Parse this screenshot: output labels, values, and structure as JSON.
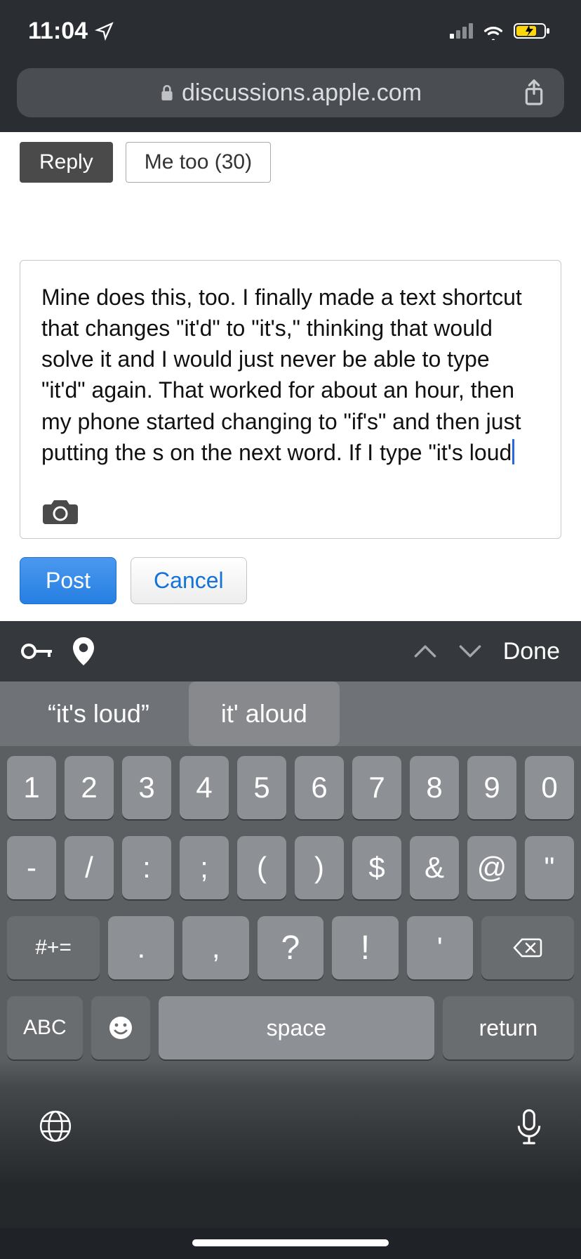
{
  "status": {
    "time": "11:04",
    "location_arrow": true,
    "cell_active_bars": 1,
    "cell_total_bars": 4,
    "wifi": true,
    "battery_charging": true
  },
  "browser": {
    "url_display": "discussions.apple.com",
    "secure": true
  },
  "thread": {
    "reply_label": "Reply",
    "me_too_label": "Me too (30)",
    "me_too_count": 30
  },
  "editor": {
    "text": "Mine does this, too. I finally made a text shortcut that changes \"it'd\" to \"it's,\" thinking that would solve it and I would just never be able to type \"it'd\" again. That worked for about an hour, then my phone started changing to \"if's\" and then just putting the s on the next word. If I type \"it's loud",
    "camera_icon": "camera-icon"
  },
  "post_buttons": {
    "post_label": "Post",
    "cancel_label": "Cancel"
  },
  "keyboard_accessory": {
    "key_icon": "key-icon",
    "pin_icon": "location-pin-icon",
    "done_label": "Done"
  },
  "suggestions": {
    "first": "“it's loud”",
    "second": "it' aloud"
  },
  "keyboard": {
    "row1": [
      "1",
      "2",
      "3",
      "4",
      "5",
      "6",
      "7",
      "8",
      "9",
      "0"
    ],
    "row2": [
      "-",
      "/",
      ":",
      ";",
      "(",
      ")",
      "$",
      "&",
      "@",
      "\""
    ],
    "row3_shift": "#+=",
    "row3": [
      ".",
      ",",
      "?",
      "!",
      "'"
    ],
    "row4_abc": "ABC",
    "row4_space": "space",
    "row4_return": "return"
  }
}
